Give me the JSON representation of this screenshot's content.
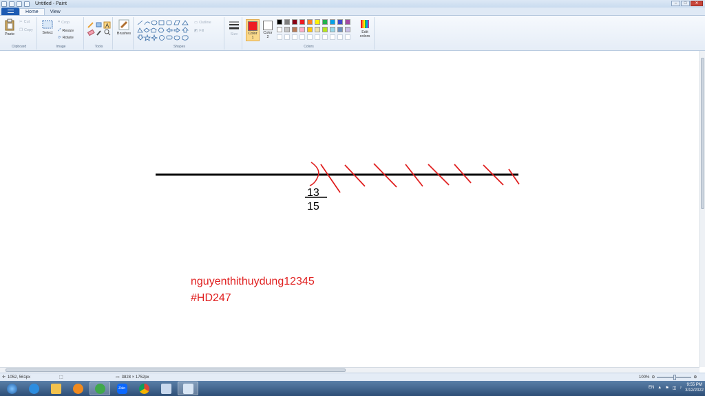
{
  "titlebar": {
    "title": "Untitled - Paint"
  },
  "tabs": [
    {
      "label": "Home"
    },
    {
      "label": "View"
    }
  ],
  "clipboard": {
    "paste": "Paste",
    "cut": "Cut",
    "copy": "Copy",
    "group": "Clipboard"
  },
  "image": {
    "select": "Select",
    "crop": "Crop",
    "resize": "Resize",
    "rotate": "Rotate",
    "group": "Image"
  },
  "tools": {
    "group": "Tools",
    "brushes": "Brushes"
  },
  "shapes": {
    "outline": "Outline",
    "fill": "Fill",
    "group": "Shapes"
  },
  "size": {
    "label": "Size"
  },
  "colors": {
    "color1_label": "Color 1",
    "color1_line1": "Color",
    "color1_line2": "1",
    "color2_label": "Color 2",
    "color2_line1": "Color",
    "color2_line2": "2",
    "color1": "#ed1c24",
    "color2": "#ffffff",
    "edit_line1": "Edit",
    "edit_line2": "colors",
    "group": "Colors",
    "palette_row1": [
      "#000000",
      "#7f7f7f",
      "#880015",
      "#ed1c24",
      "#ff7f27",
      "#fff200",
      "#22b14c",
      "#00a2e8",
      "#3f48cc",
      "#a349a4"
    ],
    "palette_row2": [
      "#ffffff",
      "#c3c3c3",
      "#b97a57",
      "#ffaec9",
      "#ffc90e",
      "#efe4b0",
      "#b5e61d",
      "#99d9ea",
      "#7092be",
      "#c8bfe7"
    ]
  },
  "canvas": {
    "text_line1": "nguyenthithuydung12345",
    "text_line2": "#HD247",
    "fraction_numerator": "13",
    "fraction_denominator": "15",
    "text_color": "#e02020"
  },
  "status": {
    "cursor_pos": "1052, 561px",
    "image_size": "3828 × 1752px",
    "zoom": "100%"
  },
  "taskbar": {
    "apps": [
      "ie-icon",
      "explorer-icon",
      "media-player-icon",
      "app-green-icon",
      "zalo-icon",
      "chrome-icon",
      "notepad-icon",
      "paint-icon"
    ],
    "zalo_label": "Zalo",
    "lang": "EN",
    "time": "9:55 PM",
    "date": "3/12/2022"
  }
}
